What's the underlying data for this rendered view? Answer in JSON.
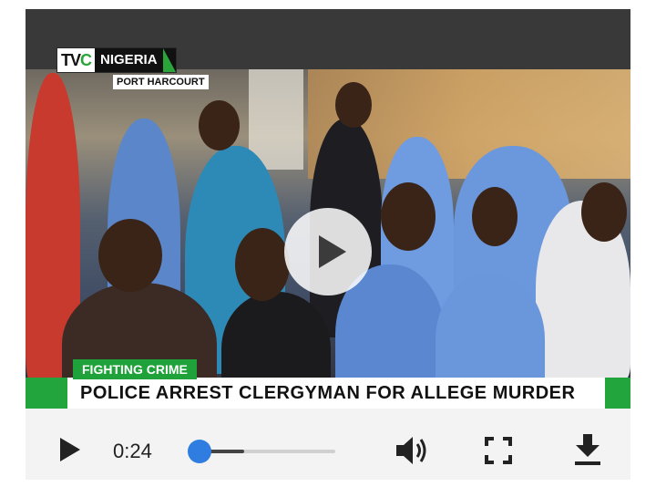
{
  "video": {
    "channel_logo_left": "TV",
    "channel_logo_c": "C",
    "channel_logo_right": "NIGERIA",
    "location": "PORT HARCOURT",
    "lower_third_tag": "FIGHTING CRIME",
    "headline": "POLICE ARREST CLERGYMAN FOR ALLEGE MURDER"
  },
  "controls": {
    "current_time": "0:24",
    "progress_fraction": 0.2,
    "icons": [
      "play-icon",
      "volume-icon",
      "fullscreen-icon",
      "download-icon"
    ],
    "accent_color": "#2f7de1"
  }
}
